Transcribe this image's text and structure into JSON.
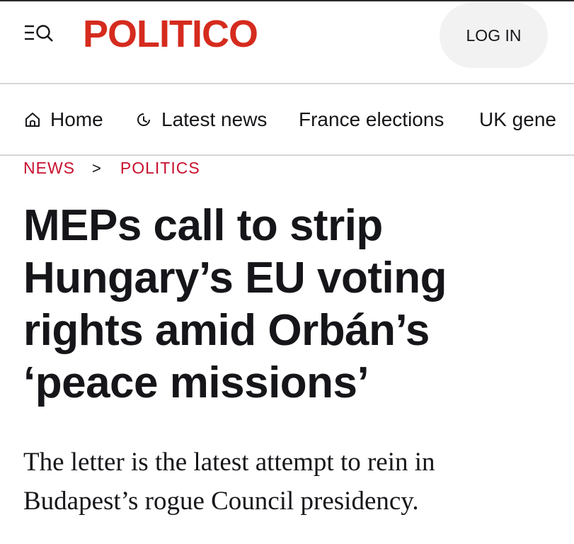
{
  "header": {
    "menu_icon": "menu-search-icon",
    "logo_text": "POLITICO",
    "login_label": "LOG IN",
    "brand_color": "#d52b1e"
  },
  "nav": {
    "items": [
      {
        "label": "Home",
        "icon": "home-icon"
      },
      {
        "label": "Latest news",
        "icon": "clock-icon"
      },
      {
        "label": "France elections"
      },
      {
        "label": "UK gene"
      }
    ]
  },
  "breadcrumb": {
    "items": [
      "NEWS",
      "POLITICS"
    ],
    "separator": ">",
    "color": "#c8102e"
  },
  "article": {
    "headline_lines": [
      "MEPs call to strip",
      "Hungary’s EU voting",
      "rights amid Orbán’s",
      "‘peace missions’"
    ],
    "subhead_lines": [
      "The letter is the latest attempt to rein in",
      "Budapest’s rogue Council presidency."
    ]
  }
}
